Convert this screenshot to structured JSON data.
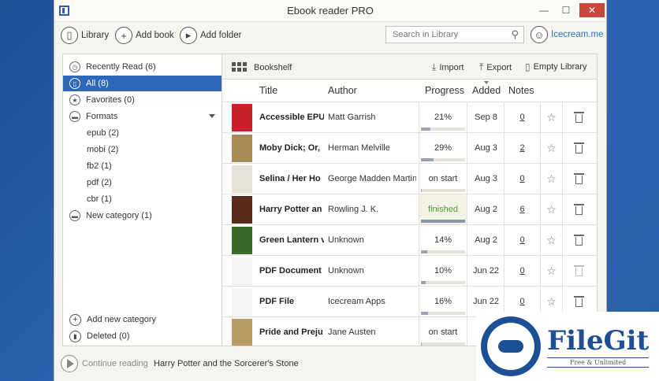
{
  "window": {
    "title": "Ebook reader PRO",
    "controls": {
      "minimize": "—",
      "maximize": "☐",
      "close": "✕"
    }
  },
  "toolbar": {
    "library": "Library",
    "add_book": "Add book",
    "add_folder": "Add folder",
    "search_placeholder": "Search in Library",
    "account": "Icecream.me"
  },
  "sidebar": {
    "items": [
      {
        "label": "Recently Read (6)",
        "icon": "clock-icon"
      },
      {
        "label": "All (8)",
        "icon": "book-icon",
        "active": true
      },
      {
        "label": "Favorites (0)",
        "icon": "star-icon"
      },
      {
        "label": "Formats",
        "icon": "folder-icon"
      }
    ],
    "formats": [
      "epub (2)",
      "mobi (2)",
      "fb2 (1)",
      "pdf (2)",
      "cbr (1)"
    ],
    "new_category": "New category (1)",
    "add_new_category": "Add new category",
    "deleted": "Deleted (0)"
  },
  "bookshelf": {
    "title": "Bookshelf",
    "import": "Import",
    "export": "Export",
    "empty_library": "Empty Library",
    "columns": {
      "title": "Title",
      "author": "Author",
      "progress": "Progress",
      "added": "Added",
      "notes": "Notes"
    },
    "rows": [
      {
        "title": "Accessible EPUB",
        "author": "Matt Garrish",
        "progress": "21%",
        "progress_value": 0.21,
        "added": "Sep 8",
        "notes": "0",
        "cover": "#c8202a"
      },
      {
        "title": "Moby Dick; Or,",
        "author": "Herman Melville",
        "progress": "29%",
        "progress_value": 0.29,
        "added": "Aug 3",
        "notes": "2",
        "cover": "#a88b58"
      },
      {
        "title": "Selina / Her Ho",
        "author": "George Madden Martin",
        "progress": "on start",
        "progress_value": 0.02,
        "added": "Aug 3",
        "notes": "0",
        "cover": "#e6e2da"
      },
      {
        "title": "Harry Potter an",
        "author": "Rowling J. K.",
        "progress": "finished",
        "progress_value": 1.0,
        "added": "Aug 2",
        "notes": "6",
        "cover": "#5a2a1a"
      },
      {
        "title": "Green Lantern v",
        "author": "Unknown",
        "progress": "14%",
        "progress_value": 0.14,
        "added": "Aug 2",
        "notes": "0",
        "cover": "#3a6a2a"
      },
      {
        "title": "PDF Document",
        "author": "Unknown",
        "progress": "10%",
        "progress_value": 0.1,
        "added": "Jun 22",
        "notes": "0",
        "cover": "#f4f4f2"
      },
      {
        "title": "PDF File",
        "author": "Icecream Apps",
        "progress": "16%",
        "progress_value": 0.16,
        "added": "Jun 22",
        "notes": "0",
        "cover": "#f4f4f2"
      },
      {
        "title": "Pride and Preju",
        "author": "Jane Austen",
        "progress": "on start",
        "progress_value": 0.02,
        "added": "J",
        "notes": "",
        "cover": "#b89a64"
      }
    ]
  },
  "status": {
    "continue_label": "Continue reading",
    "book": "Harry Potter and the Sorcerer's Stone"
  },
  "watermark": {
    "name": "FileGit",
    "tagline": "Free & Unlimited"
  }
}
